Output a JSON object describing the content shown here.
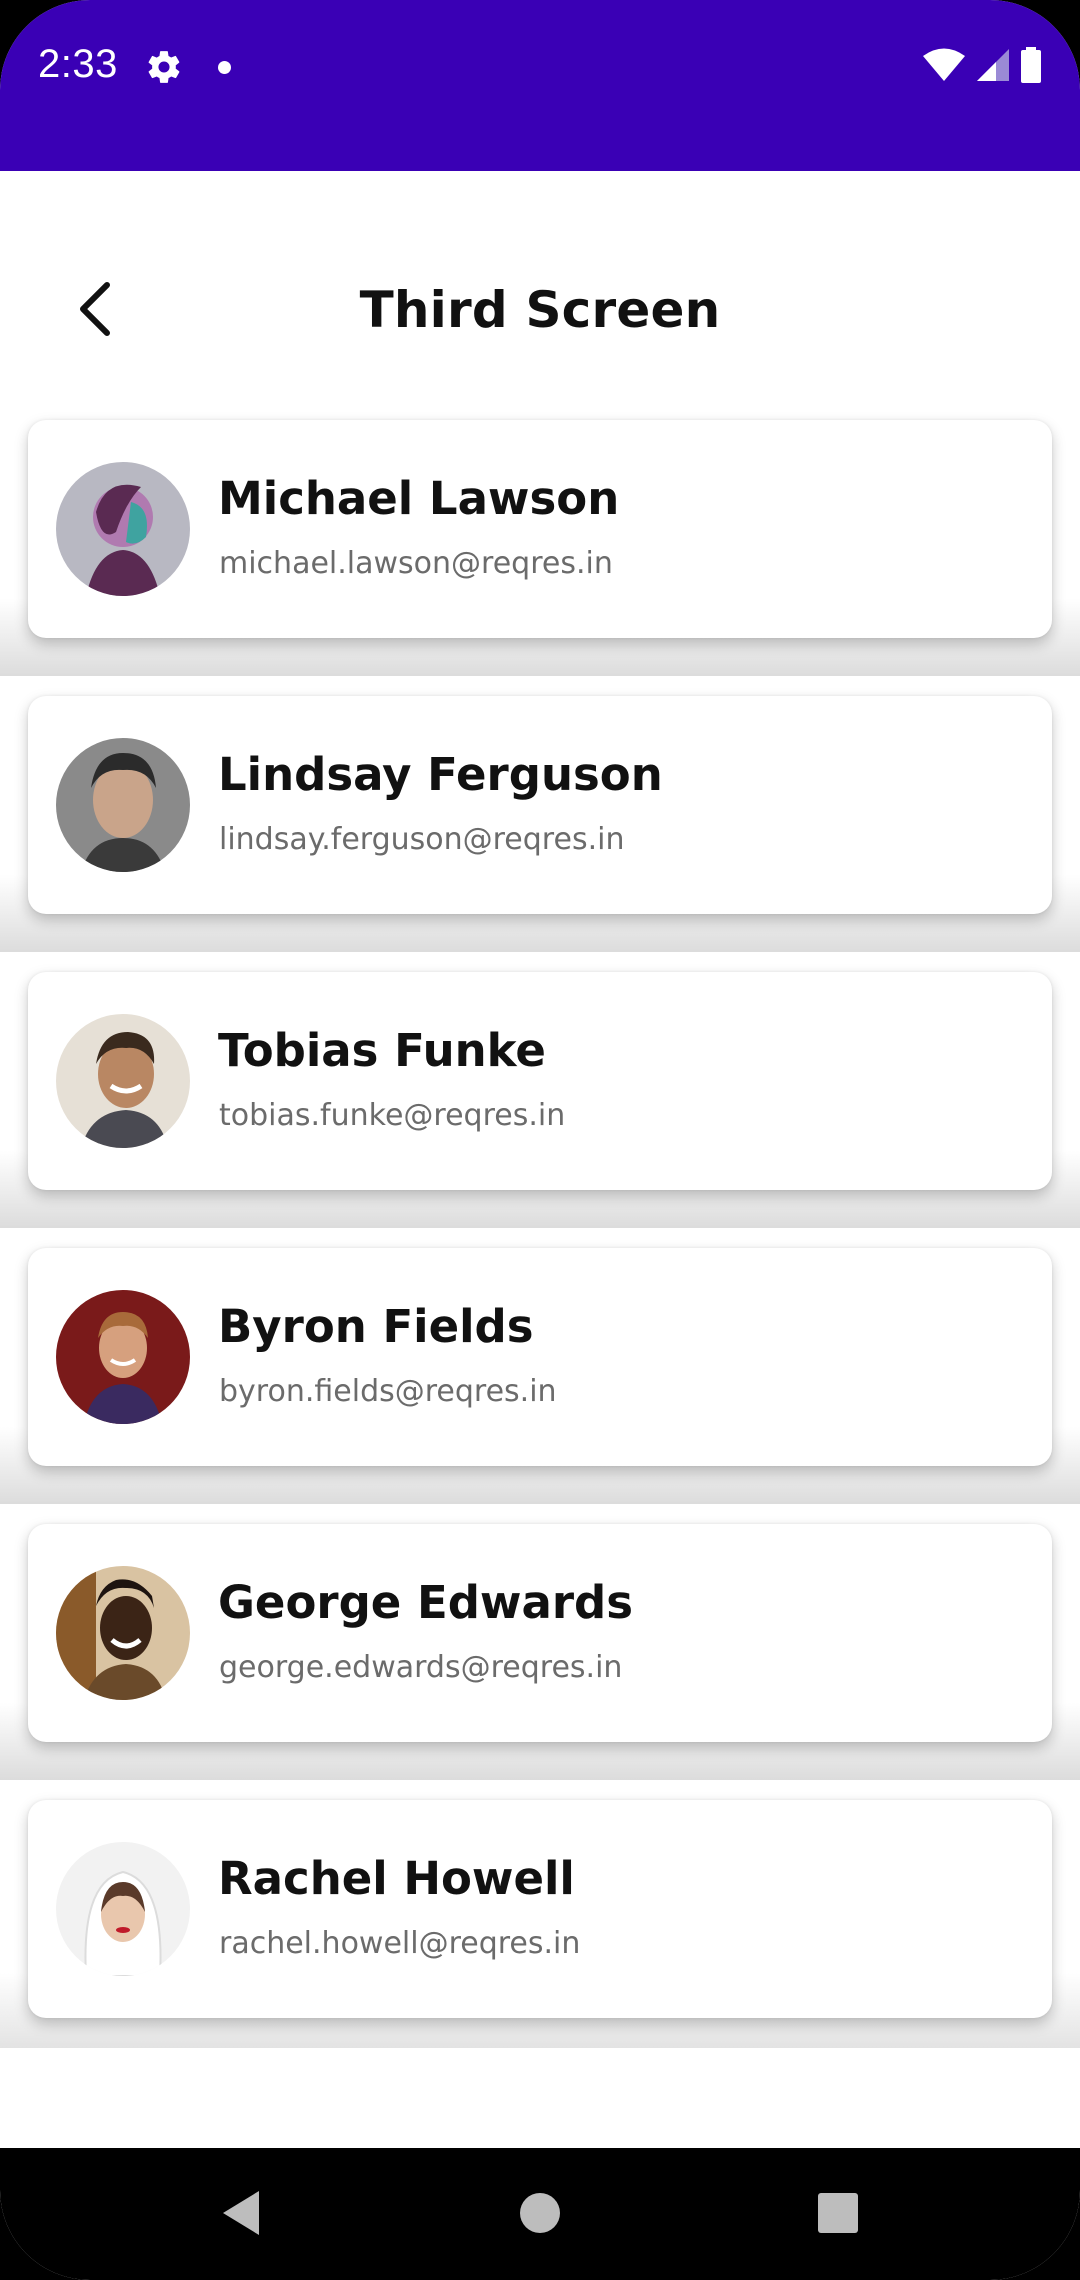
{
  "status_bar": {
    "time": "2:33",
    "icons": [
      "gear-icon",
      "notification-dot-icon",
      "wifi-icon",
      "signal-icon",
      "battery-icon"
    ],
    "background": "#3a00b5"
  },
  "app_bar": {
    "title": "Third Screen",
    "back_icon": "chevron-left-icon"
  },
  "users": [
    {
      "name": "Michael Lawson",
      "email": "michael.lawson@reqres.in",
      "avatar_colors": [
        "#5a2a52",
        "#3fa3a0",
        "#b07ab0"
      ]
    },
    {
      "name": "Lindsay Ferguson",
      "email": "lindsay.ferguson@reqres.in",
      "avatar_colors": [
        "#2b2b2b",
        "#c9a48a",
        "#8a8a8a"
      ]
    },
    {
      "name": "Tobias Funke",
      "email": "tobias.funke@reqres.in",
      "avatar_colors": [
        "#3a2a1e",
        "#b98763",
        "#e6e0d6"
      ]
    },
    {
      "name": "Byron Fields",
      "email": "byron.fields@reqres.in",
      "avatar_colors": [
        "#7a1a1a",
        "#d6a07e",
        "#3a2a60"
      ]
    },
    {
      "name": "George Edwards",
      "email": "george.edwards@reqres.in",
      "avatar_colors": [
        "#8a5a2a",
        "#3b2416",
        "#d9c3a2"
      ]
    },
    {
      "name": "Rachel Howell",
      "email": "rachel.howell@reqres.in",
      "avatar_colors": [
        "#f2f2f2",
        "#e9c7ad",
        "#5a3a2a"
      ]
    }
  ],
  "nav_bar": {
    "buttons": [
      "back-triangle-icon",
      "home-circle-icon",
      "recents-square-icon"
    ]
  }
}
